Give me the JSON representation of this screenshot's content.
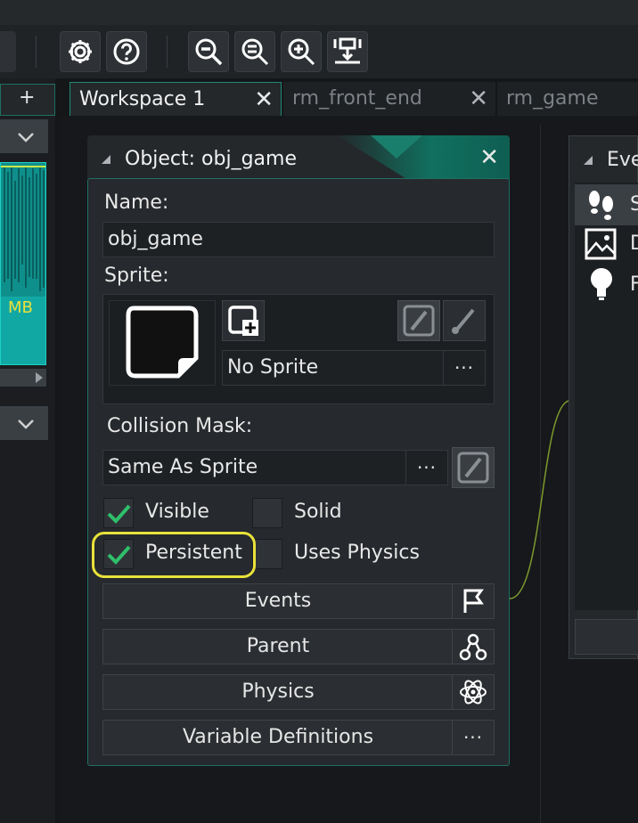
{
  "toolbar": {
    "icons": [
      "settings-icon",
      "help-icon",
      "zoom-out-icon",
      "zoom-reset-icon",
      "zoom-in-icon",
      "fit-icon"
    ]
  },
  "left_panel": {
    "add_label": "+",
    "memory_label": "MB"
  },
  "tabs": [
    {
      "label": "Workspace 1",
      "active": true
    },
    {
      "label": "rm_front_end",
      "active": false
    },
    {
      "label": "rm_game",
      "active": false
    }
  ],
  "object_editor": {
    "title": "Object: obj_game",
    "name_label": "Name:",
    "name_value": "obj_game",
    "sprite_label": "Sprite:",
    "sprite_value": "No Sprite",
    "collision_label": "Collision Mask:",
    "collision_value": "Same As Sprite",
    "checkboxes": [
      {
        "label": "Visible",
        "checked": true
      },
      {
        "label": "Solid",
        "checked": false
      },
      {
        "label": "Persistent",
        "checked": true
      },
      {
        "label": "Uses Physics",
        "checked": false
      }
    ],
    "buttons": {
      "events": "Events",
      "parent": "Parent",
      "physics": "Physics",
      "variables": "Variable Definitions"
    },
    "more": "···"
  },
  "events_panel": {
    "title": "Eve",
    "items": [
      "S",
      "D",
      "F"
    ]
  },
  "colors": {
    "accent": "#1fa896",
    "check": "#39d07a",
    "highlight": "#e8e23a"
  }
}
